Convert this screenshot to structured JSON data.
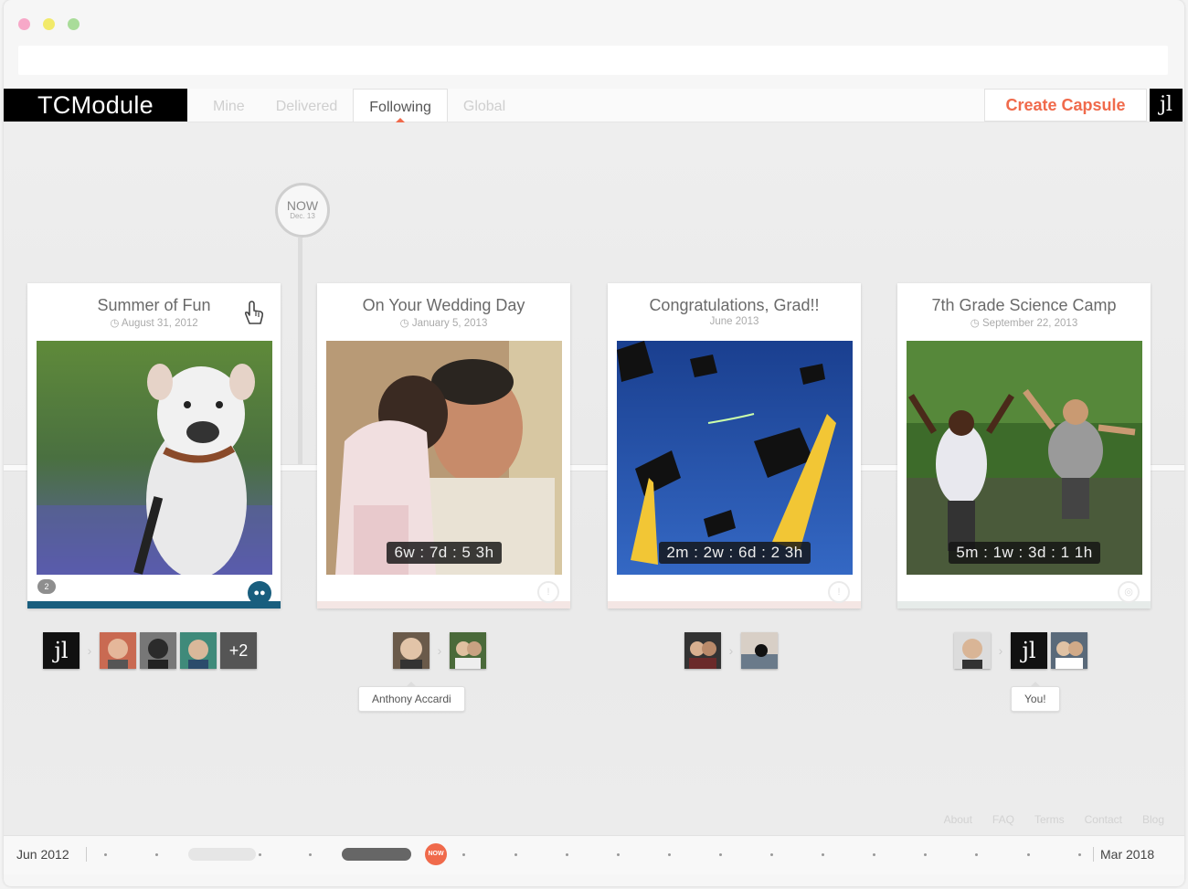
{
  "nav": {
    "brand": "TCModule",
    "tabs": [
      {
        "label": "Mine"
      },
      {
        "label": "Delivered"
      },
      {
        "label": "Following"
      },
      {
        "label": "Global"
      }
    ],
    "active_tab": "Following",
    "create_label": "Create Capsule",
    "jl_label": "jl"
  },
  "now_marker": {
    "label": "NOW",
    "date": "Dec. 13"
  },
  "cards": [
    {
      "title": "Summer of Fun",
      "date": "August 31, 2012",
      "countdown": "",
      "comments": "2"
    },
    {
      "title": "On Your Wedding Day",
      "date": "January 5, 2013",
      "countdown": "6w : 7d : 5  3h"
    },
    {
      "title": "Congratulations, Grad!!",
      "date": "June 2013",
      "countdown": "2m : 2w : 6d : 2  3h"
    },
    {
      "title": "7th Grade Science Camp",
      "date": "September 22, 2013",
      "countdown": "5m : 1w : 3d : 1  1h"
    }
  ],
  "people": {
    "card1_more": "+2",
    "jl": "jl"
  },
  "tooltips": {
    "card2": "Anthony Accardi",
    "card4": "You!"
  },
  "footer": {
    "links": [
      "About",
      "FAQ",
      "Terms",
      "Contact",
      "Blog"
    ]
  },
  "timeline": {
    "start": "Jun 2012",
    "end": "Mar 2018",
    "now": "NOW"
  },
  "colors": {
    "accent": "#f06a4b",
    "brand_bg": "#000000",
    "card1_bar": "#195e7e",
    "card_bar_pink": "#f4e6e4"
  }
}
